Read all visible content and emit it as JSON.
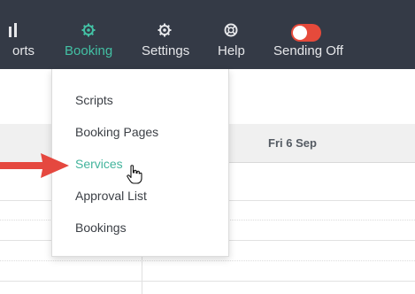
{
  "nav": {
    "reports_label": "orts",
    "booking_label": "Booking",
    "settings_label": "Settings",
    "help_label": "Help",
    "sending_label": "Sending Off"
  },
  "calendar": {
    "day_label": "Fri 6 Sep"
  },
  "dropdown": {
    "items": [
      {
        "label": "Scripts"
      },
      {
        "label": "Booking Pages"
      },
      {
        "label": "Services"
      },
      {
        "label": "Approval List"
      },
      {
        "label": "Bookings"
      }
    ]
  },
  "colors": {
    "navbar": "#343a46",
    "accent": "#43c0a4",
    "toggle_off": "#e64a3b",
    "arrow": "#e5483f"
  },
  "toggle": {
    "state": "off"
  }
}
